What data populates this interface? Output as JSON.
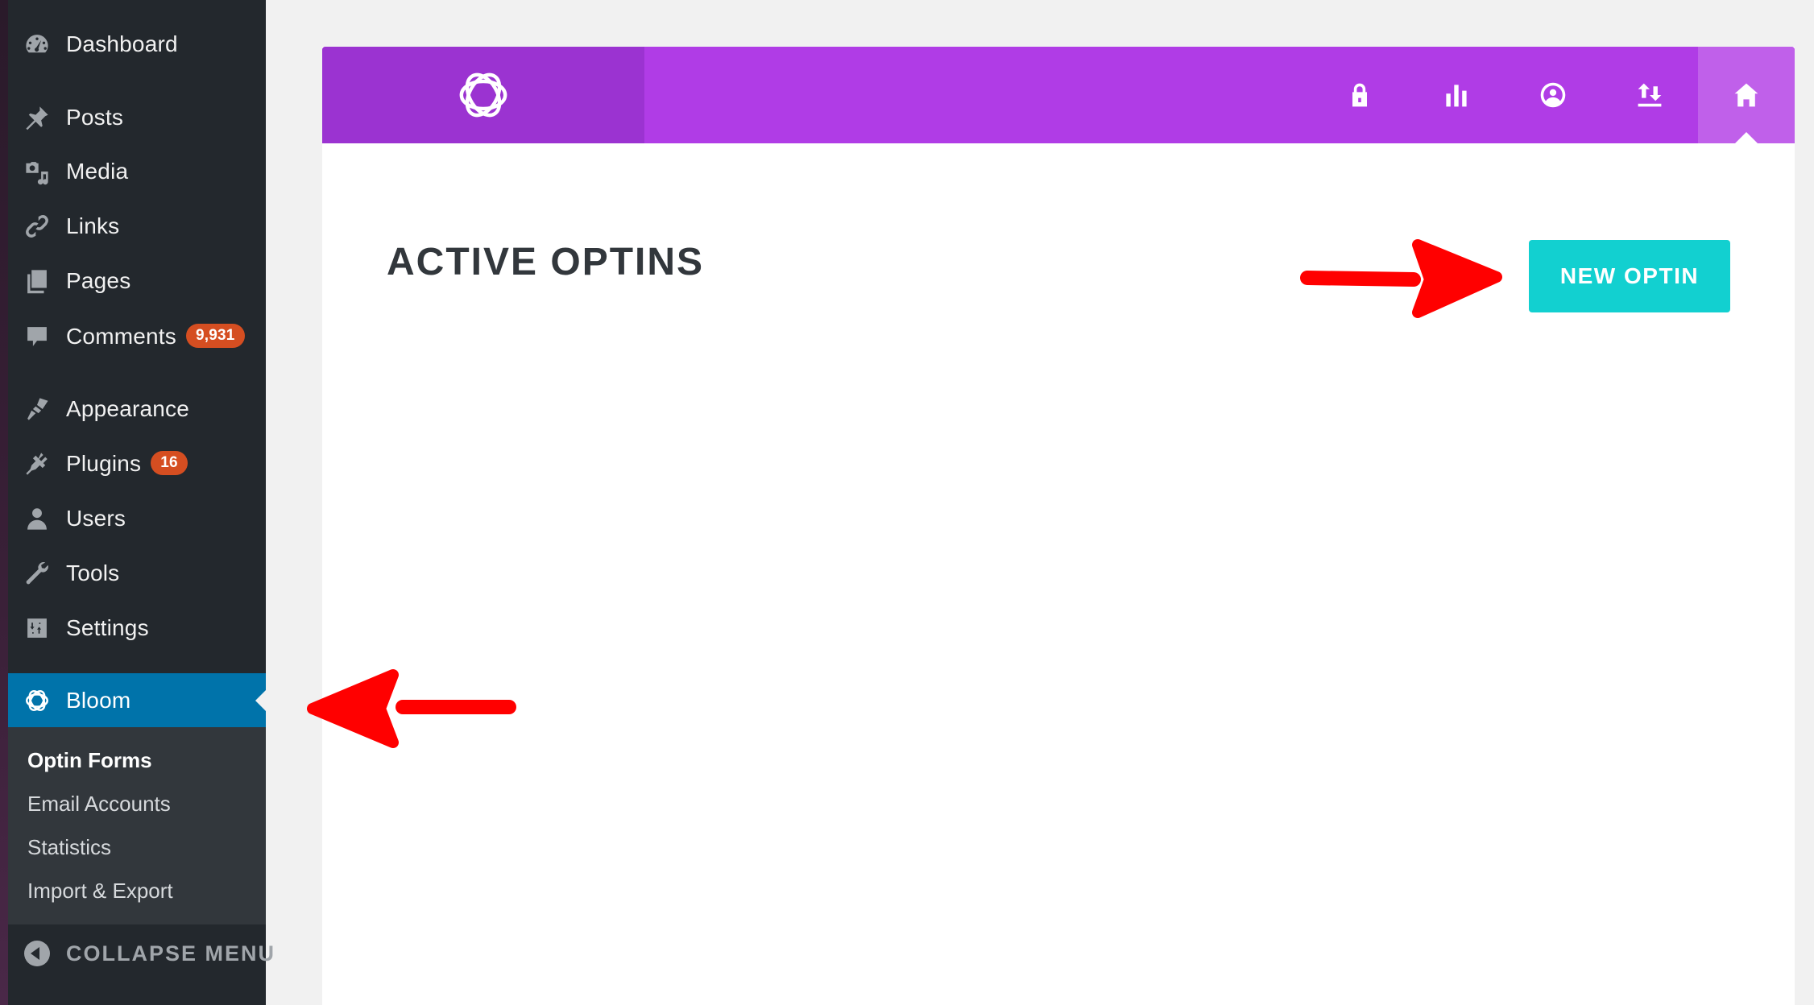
{
  "sidebar": {
    "items": [
      {
        "label": "Dashboard",
        "icon": "dashboard-icon"
      },
      {
        "label": "Posts",
        "icon": "pushpin-icon"
      },
      {
        "label": "Media",
        "icon": "media-icon"
      },
      {
        "label": "Links",
        "icon": "link-icon"
      },
      {
        "label": "Pages",
        "icon": "pages-icon"
      },
      {
        "label": "Comments",
        "icon": "comment-icon",
        "badge": "9,931"
      },
      {
        "label": "Appearance",
        "icon": "paintbrush-icon"
      },
      {
        "label": "Plugins",
        "icon": "plug-icon",
        "badge": "16"
      },
      {
        "label": "Users",
        "icon": "user-icon"
      },
      {
        "label": "Tools",
        "icon": "wrench-icon"
      },
      {
        "label": "Settings",
        "icon": "settings-icon"
      },
      {
        "label": "Bloom",
        "icon": "bloom-icon",
        "active": true
      }
    ],
    "submenu": [
      {
        "label": "Optin Forms",
        "current": true
      },
      {
        "label": "Email Accounts"
      },
      {
        "label": "Statistics"
      },
      {
        "label": "Import & Export"
      }
    ],
    "collapse_label": "COLLAPSE MENU"
  },
  "header": {
    "logo": "bloom-logo-icon",
    "nav_icons": [
      "lock-icon",
      "bar-chart-icon",
      "account-circle-icon",
      "import-export-icon",
      "home-icon"
    ],
    "active_nav": "home-icon"
  },
  "main": {
    "title": "ACTIVE OPTINS",
    "new_optin_label": "NEW OPTIN"
  },
  "colors": {
    "header_purple": "#b03ce6",
    "logo_block_purple": "#9b33d1",
    "active_nav_purple": "#c060ea",
    "button_teal": "#12d0d0",
    "wp_active_blue": "#0073aa",
    "badge_orange": "#d54e21",
    "annotation_red": "#ff0000"
  }
}
